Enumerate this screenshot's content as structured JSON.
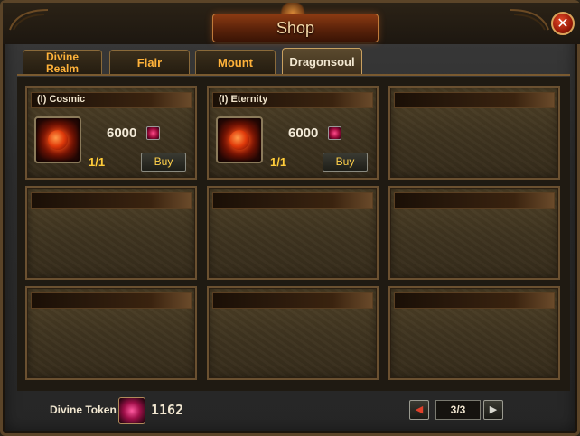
{
  "window": {
    "title": "Shop",
    "close_glyph": "✕"
  },
  "tabs": [
    {
      "label_line1": "Divine",
      "label_line2": "Realm",
      "active": false
    },
    {
      "label_line1": "Flair",
      "label_line2": "",
      "active": false
    },
    {
      "label_line1": "Mount",
      "label_line2": "",
      "active": false
    },
    {
      "label_line1": "Dragonsoul",
      "label_line2": "",
      "active": true
    }
  ],
  "items": [
    {
      "name": "(I) Cosmic",
      "price": "6000",
      "quantity": "1/1",
      "buy_label": "Buy",
      "icon": "cosmic-orb-icon"
    },
    {
      "name": "(I) Eternity",
      "price": "6000",
      "quantity": "1/1",
      "buy_label": "Buy",
      "icon": "eternity-orb-icon"
    }
  ],
  "footer": {
    "currency_label": "Divine Token",
    "currency_amount": "1162",
    "currency_icon": "divine-token-icon",
    "page": "3/3",
    "prev_glyph": "◀",
    "next_glyph": "▶"
  },
  "colors": {
    "accent": "#ffb23a",
    "quantity": "#ffcc3a",
    "active_prev_arrow": "#e0402a"
  }
}
